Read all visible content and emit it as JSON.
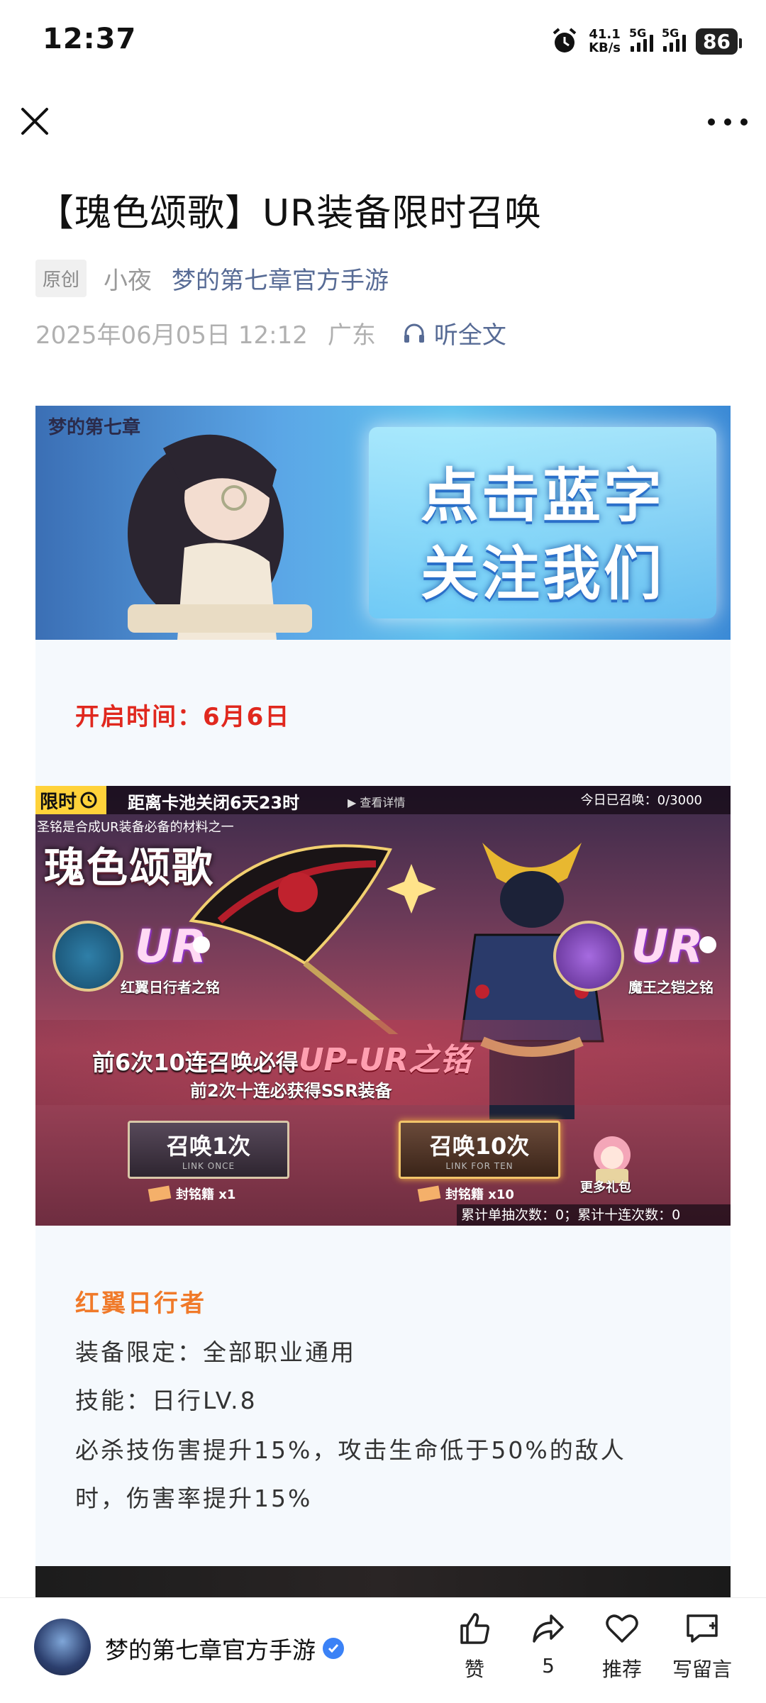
{
  "status_bar": {
    "time": "12:37",
    "net_speed_value": "41.1",
    "net_speed_unit": "KB/s",
    "sim1": "5G",
    "sim2": "5G",
    "battery": "86"
  },
  "nav": {
    "close": "close",
    "more": "more"
  },
  "article": {
    "title": "【瑰色颂歌】UR装备限时召唤",
    "tag": "原创",
    "author": "小夜",
    "account": "梦的第七章官方手游",
    "date": "2025年06月05日 12:12",
    "location": "广东",
    "listen": "听全文"
  },
  "banner": {
    "line1": "点击蓝字",
    "line2": "关注我们",
    "logo": "梦的第七章"
  },
  "open_time": "开启时间：6月6日",
  "game_image": {
    "limited": "限时",
    "countdown": "距离卡池关闭6天23时",
    "detail": "▶ 查看详情",
    "today": "今日已召唤：0/3000",
    "subtitle": "圣铭是合成UR装备必备的材料之一",
    "title": "瑰色颂歌",
    "ur_left": "UR",
    "ur_right": "UR",
    "left_item": "红翼日行者之铭",
    "right_item": "魔王之铠之铭",
    "guarantee_prefix": "前6次10连召唤必得",
    "guarantee_item": "UP-UR之铭",
    "ssr_note": "前2次十连必获得SSR装备",
    "btn_once": "召唤1次",
    "btn_once_sub": "LINK ONCE",
    "btn_ten": "召唤10次",
    "btn_ten_sub": "LINK FOR TEN",
    "cost_once": "封铭籍 x1",
    "cost_ten": "封铭籍 x10",
    "gift": "更多礼包",
    "counter": "累计单抽次数：0；累计十连次数：0"
  },
  "section": {
    "title": "红翼日行者",
    "line1": "装备限定：全部职业通用",
    "line2": "技能：日行LV.8",
    "line3": "必杀技伤害提升15%，攻击生命低于50%的敌人",
    "line4": "时，伤害率提升15%"
  },
  "bottom_bar": {
    "account": "梦的第七章官方手游",
    "like": "赞",
    "share": "5",
    "recommend": "推荐",
    "comment": "写留言"
  },
  "colors": {
    "accent_link": "#576b95",
    "red": "#e0281e",
    "orange": "#f07a2a",
    "verified": "#3b82f6"
  }
}
